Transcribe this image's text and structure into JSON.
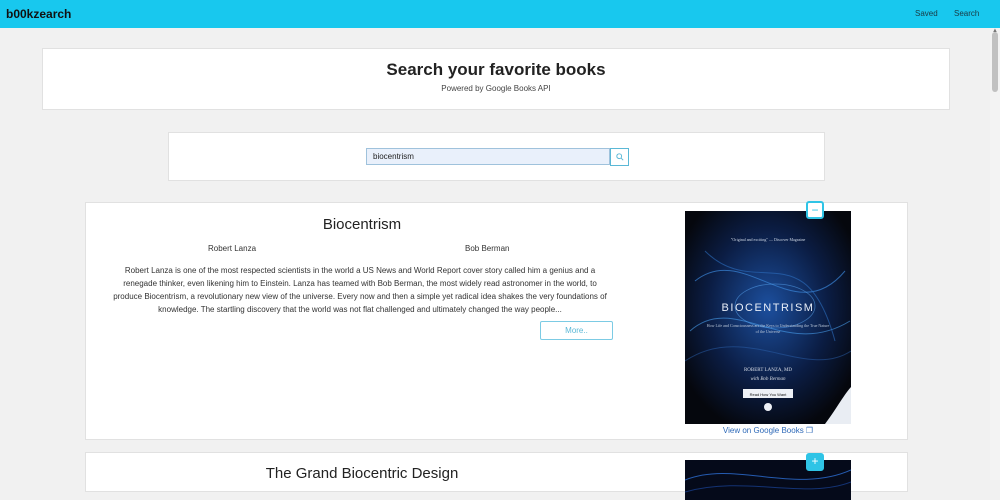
{
  "navbar": {
    "brand": "b00kzearch",
    "links": [
      "Saved",
      "Search"
    ]
  },
  "header": {
    "title": "Search your favorite books",
    "subtitle": "Powered by Google Books API"
  },
  "search": {
    "value": "biocentrism",
    "button_icon": "search-icon"
  },
  "books": [
    {
      "title": "Biocentrism",
      "authors": [
        "Robert Lanza",
        "Bob Berman"
      ],
      "description": "Robert Lanza is one of the most respected scientists in the world a US News and World Report cover story called him a genius and a renegade thinker, even likening him to Einstein. Lanza has teamed with Bob Berman, the most widely read astronomer in the world, to produce Biocentrism, a revolutionary new view of the universe. Every now and then a simple yet radical idea shakes the very foundations of knowledge. The startling discovery that the world was not flat challenged and ultimately changed the way people...",
      "more_label": "More..",
      "view_link": "View on Google Books ❐",
      "toggle": "−",
      "cover": {
        "tagline": "\"Original and exciting\" — Discover Magazine",
        "title": "BIOCENTRISM",
        "subtitle": "How Life and Consciousness are the Keys to Understanding the True Nature of the Universe",
        "author1": "ROBERT LANZA, MD",
        "author2": "with Bob Berman",
        "publisher": "Read How You Want"
      }
    },
    {
      "title": "The Grand Biocentric Design",
      "toggle": "+"
    }
  ],
  "colors": {
    "navbar": "#18c8ee",
    "accent": "#2fc4e6",
    "link": "#2f6ab8"
  }
}
